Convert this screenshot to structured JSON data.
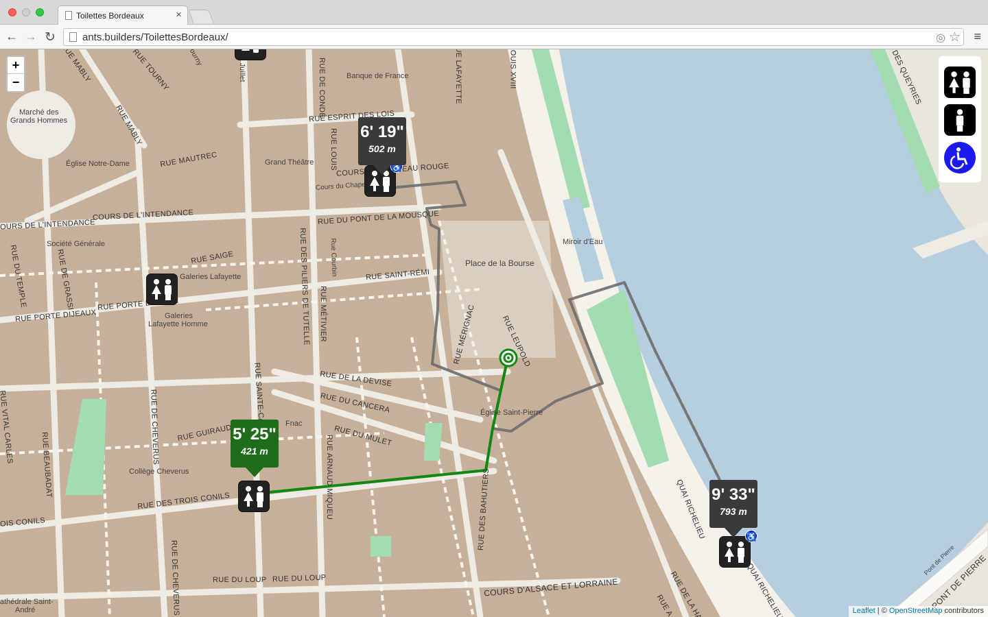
{
  "browser": {
    "tab_title": "Toilettes Bordeaux",
    "tab_close": "×",
    "url": "ants.builders/ToilettesBordeaux/",
    "back_icon": "←",
    "forward_icon": "→",
    "reload_icon": "↻",
    "location_icon": "◎",
    "star_icon": "☆",
    "menu_icon": "≡"
  },
  "zoom": {
    "in": "+",
    "out": "−"
  },
  "labels": {
    "rue_mably": "RUE MABLY",
    "rue_tourny": "RUE TOURNY",
    "rue_mably2": "RUE MABLY",
    "marche": "Marché des",
    "marche2": "Grands Hommes",
    "eglise_nd": "Église Notre-Dame",
    "rue_mautrec": "RUE MAUTREC",
    "banque": "Banque de France",
    "rue_conde": "RUE DE CONDÉ",
    "rue_lafayette": "RUE LAFAYETTE",
    "louis18": "LOUIS XVIII",
    "esprit_lois": "RUE ESPRIT DES LOIS",
    "grand_theatre": "Grand Théâtre",
    "rue_louis": "RUE LOUIS",
    "cours_chapeau": "COURS DU CHAPEAU ROUGE",
    "cours_chapeau_small": "Cours du Chapeau",
    "intendance_left": "OURS DE L'INTENDANCE",
    "intendance": "COURS DE L'INTENDANCE",
    "pont_mousque": "RUE DU PONT DE LA MOUSQUE",
    "societe_gen": "Société Générale",
    "rue_saige": "RUE SAIGE",
    "galeries": "Galeries Lafayette",
    "piliers": "RUE DES PILIERS DE TUTELLE",
    "rue_courbin": "Rue Courbin",
    "saint_remi": "RUE SAINT-RÉMI",
    "place_bourse": "Place de la Bourse",
    "miroir": "Miroir d'Eau",
    "rue_temple": "RUE DU TEMPLE",
    "rue_grassi": "RUE DE GRASSI",
    "porte_dijeaux": "RUE PORTE DIJEAUX",
    "porte_dijeaux2": "RUE PORTE DIJEAUX",
    "galeries_homme": "Galeries",
    "galeries_homme2": "Lafayette Homme",
    "rue_metivier": "RUE MÉTIVIER",
    "rue_merignac": "RUE MÉRIGNAC",
    "rue_leupold": "RUE LEUPOLD",
    "rue_devise": "RUE DE LA DEVISE",
    "rue_cancera": "RUE DU CANCERA",
    "eglise_sp": "Église Saint-Pierre",
    "rue_mulet": "RUE DU MULET",
    "fnac": "Fnac",
    "rue_guiraude": "RUE GUIRAUDE",
    "rue_sainte_cath": "RUE SAINTE-CATHERINE",
    "rue_cheverus": "RUE DE CHEVERUS",
    "college_cheverus": "Collège Cheverus",
    "carles": "RUE VITAL CARLES",
    "beaubadat": "RUE BEAUBADAT",
    "trois_conils": "RUE DES TROIS CONILS",
    "trois_conils_left": "OIS CONILS",
    "arnaud_miqueu": "RUE ARNAUD MIQUEU",
    "bahutiers": "RUE DES BAHUTIERS",
    "quai_richelieu": "QUAI RICHELIEU",
    "quai_richelieu2": "QUAI RICHELIEU",
    "rue_loup": "RUE DU LOUP",
    "rue_loup2": "RUE DU LOUP",
    "alsace": "COURS D'ALSACE ET LORRAINE",
    "cathedrale": "athédrale Saint-",
    "cathedrale2": "André",
    "rue_cheverus2": "RUE DE CHEVERUS",
    "pont_pierre": "PONT DE PIERRE",
    "pont_pierre_small": "Pont de Pierre",
    "queyries": "DES QUEYRIES",
    "rue_halle": "RUE DE LA HALLE",
    "rue_faure": "RUE A. FAURE",
    "juillet": "XX Juillet",
    "tourny2": "Tourny"
  },
  "bubbles": {
    "north": {
      "time": "6' 19\"",
      "distance": "502 m"
    },
    "west": {
      "time": "5' 25\"",
      "distance": "421 m"
    },
    "east": {
      "time": "9' 33\"",
      "distance": "793 m"
    }
  },
  "wheelchair_symbol": "♿",
  "attribution": {
    "leaflet": "Leaflet",
    "sep": " | © ",
    "osm": "OpenStreetMap",
    "contrib": " contributors"
  },
  "colors": {
    "route_active": "#118811",
    "route_inactive": "#6e6e6e",
    "water": "#b5cfe0",
    "park": "#a2dcb0",
    "block": "#c7b09a"
  }
}
